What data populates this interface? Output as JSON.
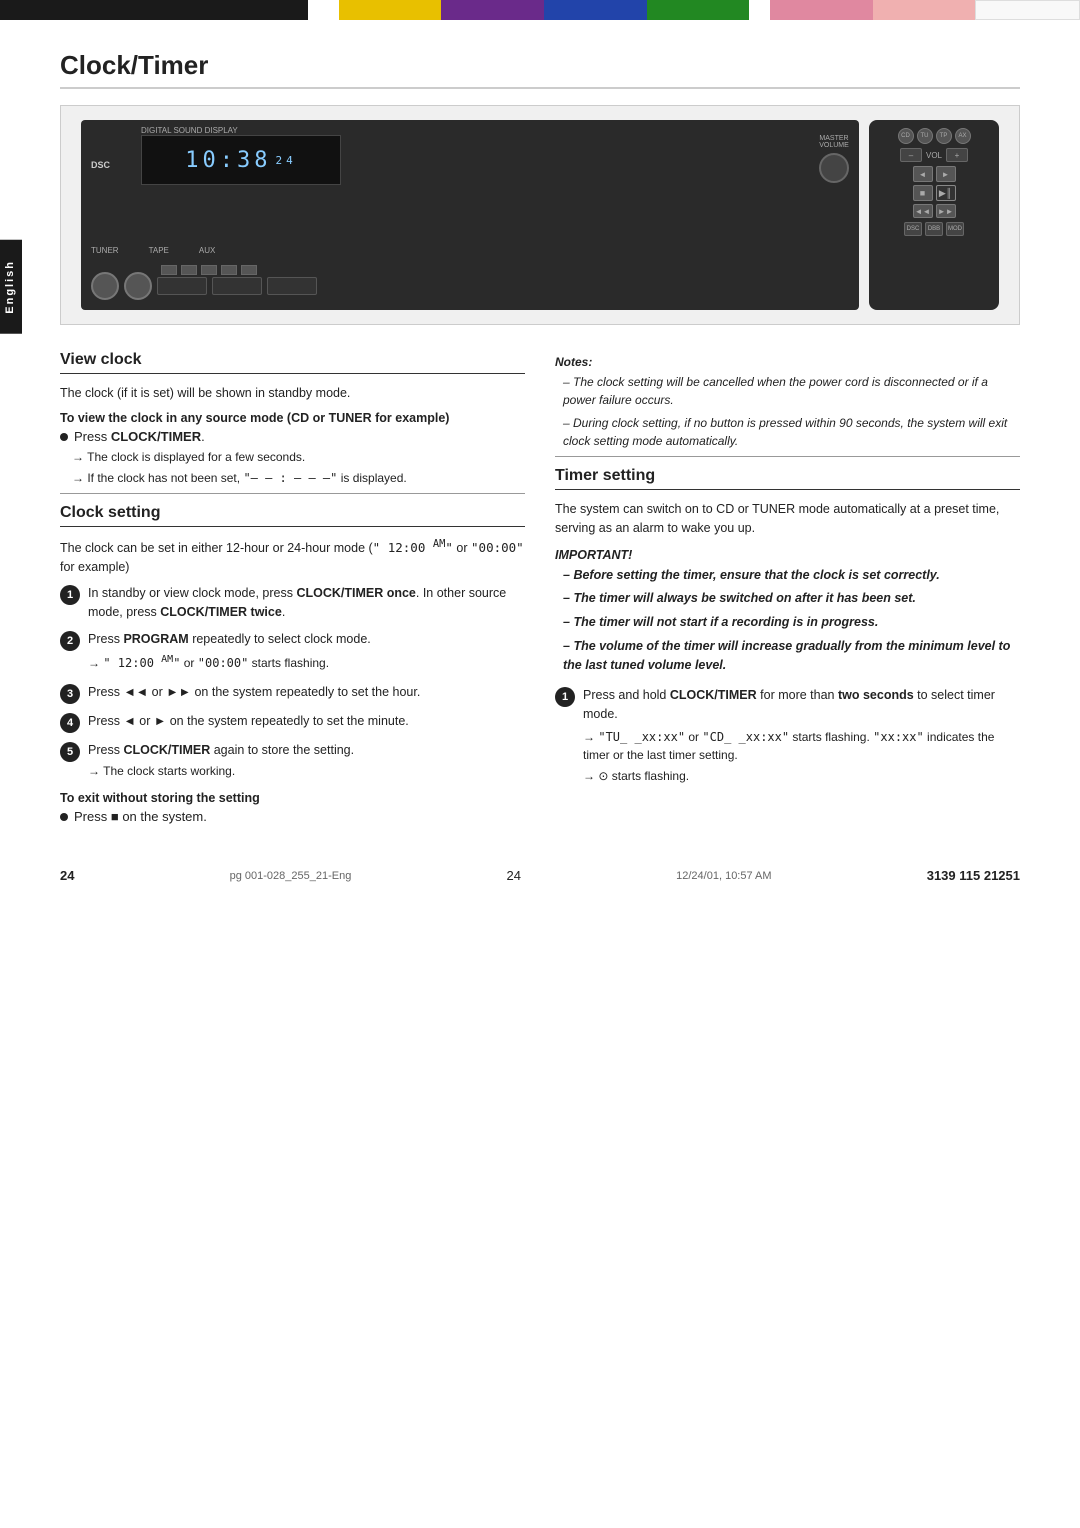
{
  "page": {
    "title": "Clock/Timer",
    "english_tab": "English",
    "page_number": "24",
    "footer_file": "pg 001-028_255_21-Eng",
    "footer_page": "24",
    "footer_date": "12/24/01, 10:57 AM",
    "footer_code": "3139 115 21251"
  },
  "device": {
    "display_time": "10:38",
    "display_suffix": "24",
    "display_label": "DIGITAL SOUND DISPLAY",
    "dsc_label": "DSC"
  },
  "view_clock": {
    "heading": "View clock",
    "intro": "The clock (if it is set) will be shown in standby mode.",
    "sub_heading": "To view the clock in any source mode (CD or TUNER for example)",
    "bullet1": "Press CLOCK/TIMER.",
    "bullet1_bold": "CLOCK/TIMER",
    "arrow1": "The clock is displayed for a few seconds.",
    "arrow2": "If the clock has not been set, \"– – : – – –\" is displayed.",
    "arrow2_display": "\"– – : – – –\""
  },
  "clock_setting": {
    "heading": "Clock setting",
    "intro": "The clock can be set in either 12-hour or 24-hour mode (\" 12:00  AM\" or \"00:00\" for example)",
    "step1": {
      "num": "1",
      "text_before": "In standby or view clock mode, press ",
      "bold1": "CLOCK/TIMER once",
      "text_middle": ".  In other source mode, press ",
      "bold2": "CLOCK/TIMER twice",
      "text_end": "."
    },
    "step2": {
      "num": "2",
      "text_before": "Press ",
      "bold": "PROGRAM",
      "text_end": " repeatedly to select clock mode.",
      "arrow": "\" 12:00  AM\" or \"00:00\" starts flashing."
    },
    "step3": {
      "num": "3",
      "text_before": "Press ",
      "bold1": "◄◄",
      "text_middle": " or ",
      "bold2": "►►",
      "text_end": " on the system repeatedly to set the hour."
    },
    "step4": {
      "num": "4",
      "text_before": "Press ",
      "bold1": "◄",
      "text_middle": " or ",
      "bold2": "►",
      "text_end": " on the system repeatedly to set the minute."
    },
    "step5": {
      "num": "5",
      "text_before": "Press ",
      "bold": "CLOCK/TIMER",
      "text_end": " again to store the setting.",
      "arrow": "The clock starts working."
    },
    "exit_heading": "To exit without storing the setting",
    "exit_bullet": "Press ■ on the system.",
    "exit_bold": "■"
  },
  "notes": {
    "title": "Notes:",
    "note1": "The clock setting will be cancelled when the power cord is disconnected or if a power failure occurs.",
    "note2": "During clock setting, if no button is pressed within 90 seconds, the system will exit clock setting mode automatically."
  },
  "timer_setting": {
    "heading": "Timer setting",
    "intro": "The system can switch on to CD or TUNER mode automatically at a preset time, serving as an alarm to wake you up.",
    "important_title": "IMPORTANT!",
    "imp1": "Before setting the timer, ensure that the clock is set correctly.",
    "imp2": "The timer will always be switched on after it has been set.",
    "imp3": "The timer will not start if a recording is in progress.",
    "imp4": "The volume of the timer will increase gradually from the minimum level to the last tuned volume level.",
    "step1": {
      "num": "1",
      "text_before": "Press and hold ",
      "bold1": "CLOCK/TIMER",
      "text_middle": " for more than ",
      "bold2": "two seconds",
      "text_end": " to select timer mode.",
      "arrow1": "\"TU_ _xx:xx\" or \"CD_ _xx:xx\" starts flashing. \"xx:xx\" indicates the timer or the last timer setting.",
      "arrow2": "⊙ starts flashing."
    }
  }
}
